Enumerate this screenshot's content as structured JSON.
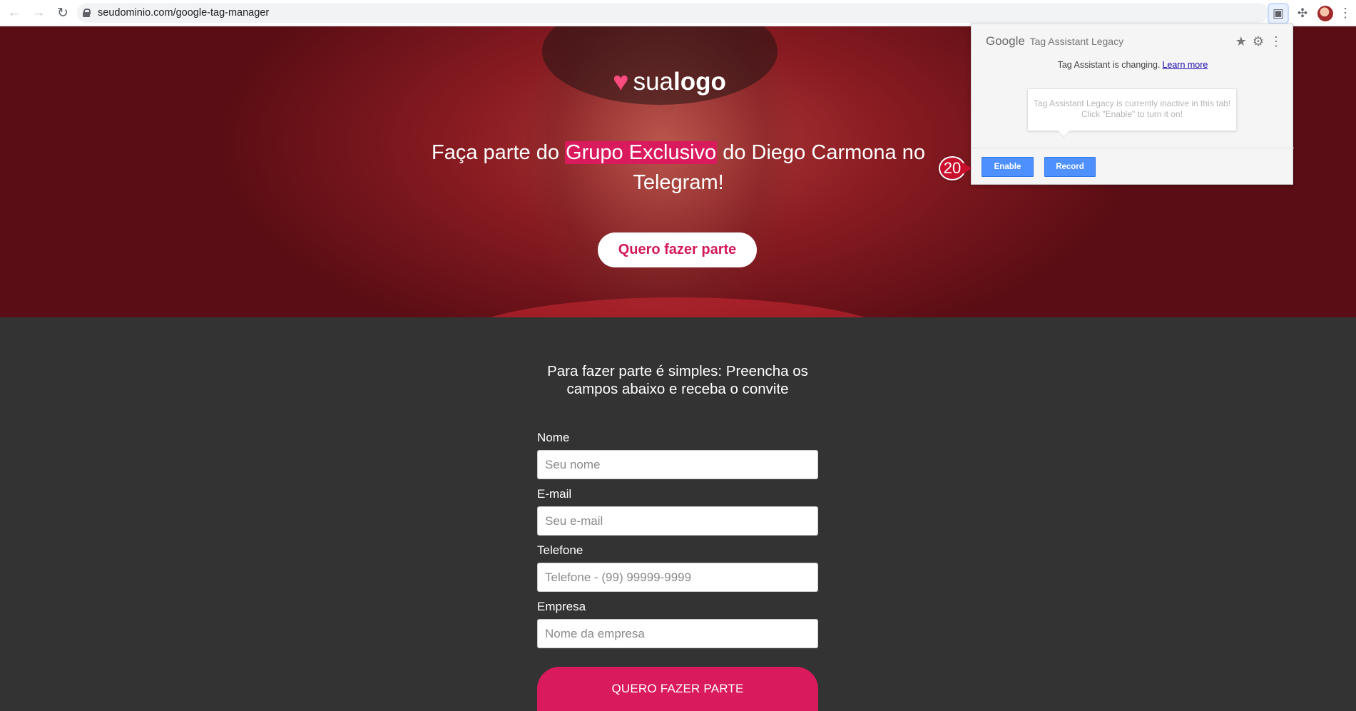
{
  "browser": {
    "url": "seudominio.com/google-tag-manager",
    "back_icon": "←",
    "forward_icon": "→",
    "reload_icon": "↻",
    "extension_icon": "▣",
    "puzzle_icon": "✣",
    "menu_icon": "⋮"
  },
  "hero": {
    "logo_light": "sua",
    "logo_bold": "logo",
    "heart": "♥",
    "headline_before": "Faça parte do ",
    "headline_highlight": "Grupo Exclusivo",
    "headline_after": " do Diego Carmona no Telegram!",
    "cta_label": "Quero fazer parte"
  },
  "form": {
    "intro": "Para fazer parte é simples: Preencha os campos abaixo e receba o convite",
    "fields": [
      {
        "label": "Nome",
        "placeholder": "Seu nome"
      },
      {
        "label": "E-mail",
        "placeholder": "Seu e-mail"
      },
      {
        "label": "Telefone",
        "placeholder": "Telefone - (99) 99999-9999"
      },
      {
        "label": "Empresa",
        "placeholder": "Nome da empresa"
      }
    ],
    "submit_label": "QUERO FAZER PARTE"
  },
  "tag_assistant": {
    "brand": "Google",
    "app_name": "Tag Assistant Legacy",
    "star_icon": "★",
    "gear_icon": "⚙",
    "more_icon": "⋮",
    "notice": "Tag Assistant is changing.",
    "learn_more": "Learn more",
    "bubble_text": "Tag Assistant Legacy is currently inactive in this tab! Click \"Enable\" to turn it on!",
    "enable_label": "Enable",
    "record_label": "Record"
  },
  "annotation": {
    "step_number": "20"
  },
  "colors": {
    "accent": "#d91a5c",
    "hero_red": "#8a1c22",
    "dark_bg": "#333333",
    "button_blue": "#4d90fe"
  }
}
